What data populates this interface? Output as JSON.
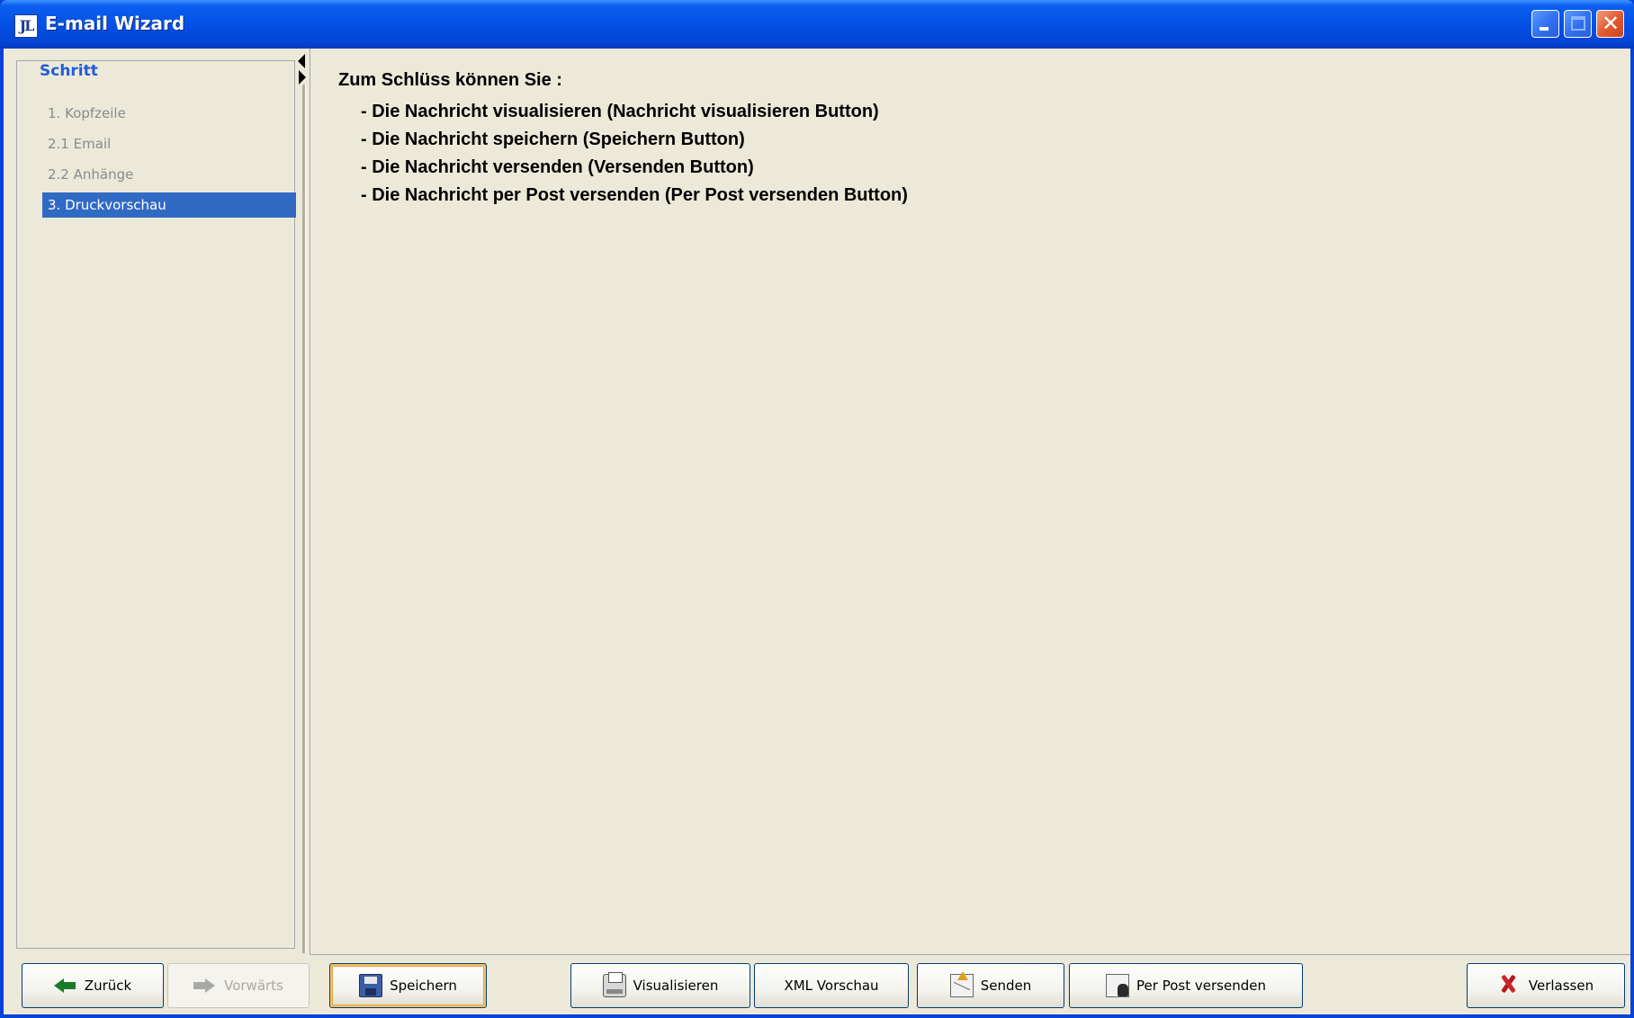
{
  "window": {
    "title": "E-mail Wizard",
    "app_icon_text": "JL"
  },
  "steps": {
    "legend": "Schritt",
    "items": [
      {
        "label": "1. Kopfzeile",
        "selected": false
      },
      {
        "label": "2.1 Email",
        "selected": false
      },
      {
        "label": "2.2 Anhänge",
        "selected": false
      },
      {
        "label": "3. Druckvorschau",
        "selected": true
      }
    ]
  },
  "content": {
    "intro": "Zum Schlüss können Sie :",
    "bullets": [
      "- Die Nachricht visualisieren (Nachricht visualisieren Button)",
      "- Die Nachricht speichern (Speichern Button)",
      "- Die Nachricht versenden (Versenden Button)",
      "- Die Nachricht per Post versenden (Per Post versenden Button)"
    ]
  },
  "buttons": {
    "back": {
      "label": "Zurück",
      "icon": "arrow-left-icon"
    },
    "forward": {
      "label": "Vorwärts",
      "icon": "arrow-right-icon",
      "disabled": true
    },
    "save": {
      "label": "Speichern",
      "icon": "floppy-disk-icon"
    },
    "visualize": {
      "label": "Visualisieren",
      "icon": "printer-icon"
    },
    "xml_preview": {
      "label": "XML Vorschau"
    },
    "send": {
      "label": "Senden",
      "icon": "envelope-send-icon"
    },
    "post": {
      "label": "Per Post versenden",
      "icon": "envelope-post-icon"
    },
    "exit": {
      "label": "Verlassen",
      "icon": "close-x-icon"
    }
  },
  "colors": {
    "titlebar": "#0550e6",
    "selection": "#316ac5",
    "legend": "#1f5cd8",
    "background": "#ece9d8"
  }
}
